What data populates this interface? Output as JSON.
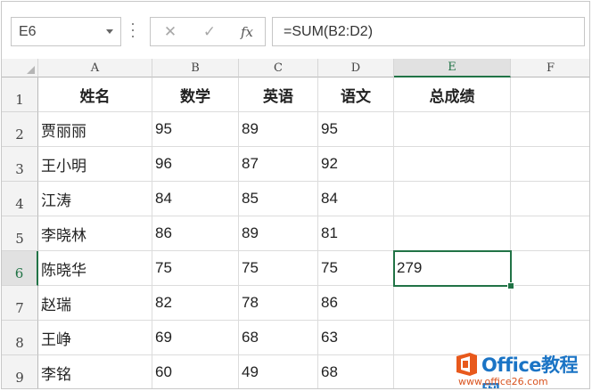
{
  "name_box": {
    "value": "E6"
  },
  "formula_bar": {
    "cancel_symbol": "✕",
    "enter_symbol": "✓",
    "fx_label": "fx",
    "formula": "=SUM(B2:D2)"
  },
  "columns": [
    "A",
    "B",
    "C",
    "D",
    "E",
    "F"
  ],
  "active_column": "E",
  "active_row": "6",
  "rows": [
    {
      "num": "1",
      "cells": [
        "姓名",
        "数学",
        "英语",
        "语文",
        "总成绩",
        ""
      ]
    },
    {
      "num": "2",
      "cells": [
        "贾丽丽",
        "95",
        "89",
        "95",
        "",
        ""
      ]
    },
    {
      "num": "3",
      "cells": [
        "王小明",
        "96",
        "87",
        "92",
        "",
        ""
      ]
    },
    {
      "num": "4",
      "cells": [
        "江涛",
        "84",
        "85",
        "84",
        "",
        ""
      ]
    },
    {
      "num": "5",
      "cells": [
        "李晓林",
        "86",
        "89",
        "81",
        "",
        ""
      ]
    },
    {
      "num": "6",
      "cells": [
        "陈晓华",
        "75",
        "75",
        "75",
        "279",
        ""
      ]
    },
    {
      "num": "7",
      "cells": [
        "赵瑞",
        "82",
        "78",
        "86",
        "",
        ""
      ]
    },
    {
      "num": "8",
      "cells": [
        "王峥",
        "69",
        "68",
        "63",
        "",
        ""
      ]
    },
    {
      "num": "9",
      "cells": [
        "李铭",
        "60",
        "49",
        "68",
        "",
        ""
      ]
    }
  ],
  "watermark": {
    "brand": "Office教程网",
    "url": "www.office26.com",
    "logo_color": "#e8591c",
    "text_color": "#1b74c5"
  },
  "colors": {
    "accent": "#217346",
    "header_bg": "#f3f3f3",
    "gridline": "#dcdcdc"
  }
}
